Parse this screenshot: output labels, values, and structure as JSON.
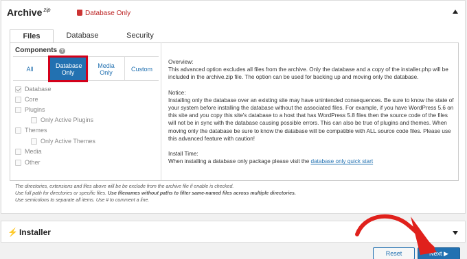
{
  "archive": {
    "title": "Archive",
    "title_suffix": "zip",
    "tag": "Database Only"
  },
  "tabs": [
    "Files",
    "Database",
    "Security"
  ],
  "components": {
    "title": "Components",
    "filters": [
      "All",
      "Database Only",
      "Media Only",
      "Custom"
    ],
    "selected_filter": "Database Only",
    "items": {
      "database": "Database",
      "core": "Core",
      "plugins": "Plugins",
      "only_active_plugins": "Only Active Plugins",
      "themes": "Themes",
      "only_active_themes": "Only Active Themes",
      "media": "Media",
      "other": "Other"
    }
  },
  "description": {
    "overview_title": "Overview:",
    "overview_text": "This advanced option excludes all files from the archive. Only the database and a copy of the installer.php will be included in the archive.zip file. The option can be used for backing up and moving only the database.",
    "notice_title": "Notice:",
    "notice_text": "Installing only the database over an existing site may have unintended consequences. Be sure to know the state of your system before installing the database without the associated files. For example, if you have WordPress 5.6 on this site and you copy this site's database to a host that has WordPress 5.8 files then the source code of the files will not be in sync with the database causing possible errors. This can also be true of plugins and themes. When moving only the database be sure to know the database will be compatible with ALL source code files. Please use this advanced feature with caution!",
    "install_time_title": "Install Time:",
    "install_time_text": "When installing a database only package please visit the ",
    "install_time_link": "database only quick start"
  },
  "notes": {
    "line1": "The directories, extensions and files above will be be exclude from the archive file if enable is checked.",
    "line2_a": "Use full path for directories or specific files. ",
    "line2_b": "Use filenames without paths to filter same-named files across multiple directories.",
    "line3": "Use semicolons to separate all items. Use # to comment a line."
  },
  "installer": {
    "title": "Installer"
  },
  "buttons": {
    "reset": "Reset",
    "next": "Next ▶"
  },
  "colors": {
    "accent": "#2271b1",
    "highlight_box": "#d3001a",
    "annotation_arrow": "#e0211c"
  },
  "icons": {
    "tag": "database-icon",
    "help": "question-circle-icon",
    "installer": "bolt-icon",
    "collapse": "caret-up-icon",
    "expand": "caret-down-icon"
  }
}
